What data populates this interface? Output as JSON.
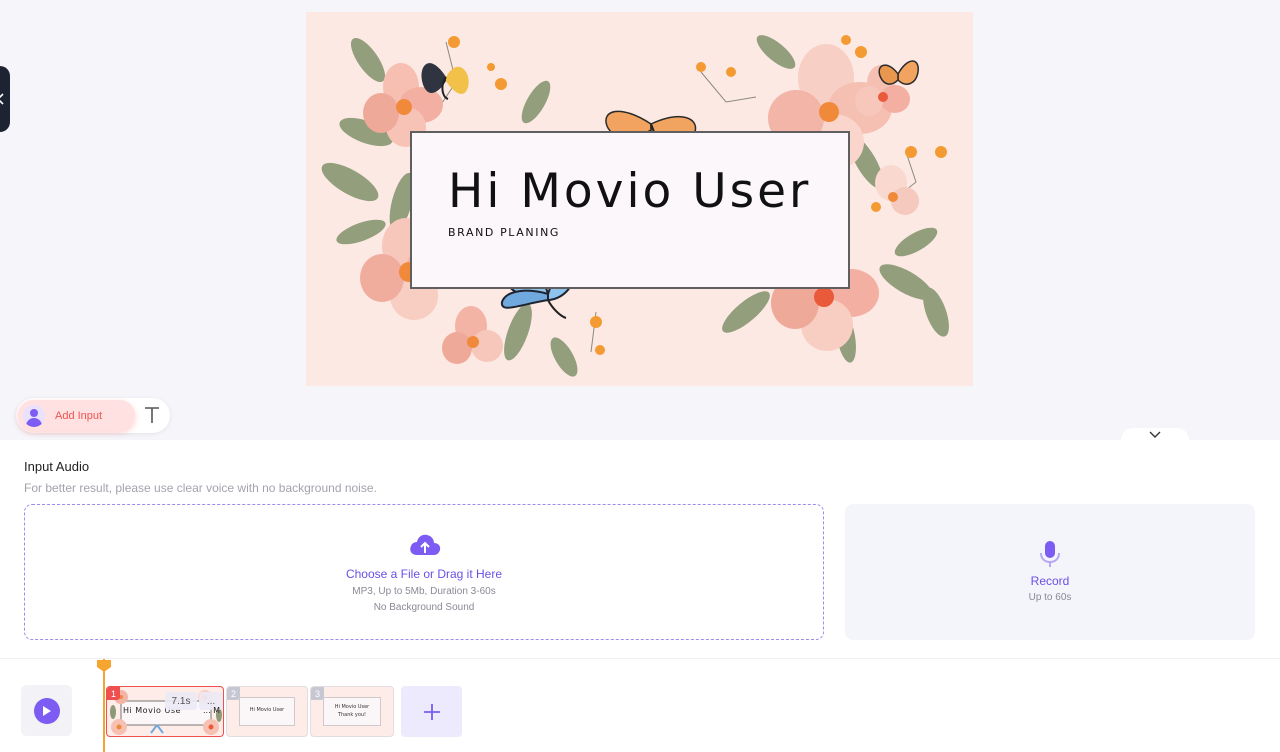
{
  "canvas": {
    "title": "Hi Movio User",
    "subtitle": "BRAND PLANING"
  },
  "toolbar": {
    "add_input_label": "Add Input",
    "text_tool_icon": "text-T-icon"
  },
  "audio": {
    "title": "Input Audio",
    "hint": "For better result, please use clear voice with no background noise.",
    "upload": {
      "label": "Choose a File or Drag it Here",
      "requirements": "MP3, Up to 5Mb, Duration 3-60s",
      "note": "No Background Sound"
    },
    "record": {
      "label": "Record",
      "limit": "Up to 60s"
    }
  },
  "timeline": {
    "scenes": [
      {
        "number": "1",
        "duration": "7.1s",
        "more": "...",
        "title": "Hi Movio Use",
        "fragment": "... M"
      },
      {
        "number": "2",
        "title": "Hi Movio User"
      },
      {
        "number": "3",
        "title": "Hi Movio User",
        "line2": "Thank you!"
      }
    ]
  },
  "colors": {
    "accent": "#7C5CF2",
    "playhead": "#F7A531",
    "selected_scene": "#EF4F4F",
    "canvas_bg": "#FDE9E3"
  }
}
